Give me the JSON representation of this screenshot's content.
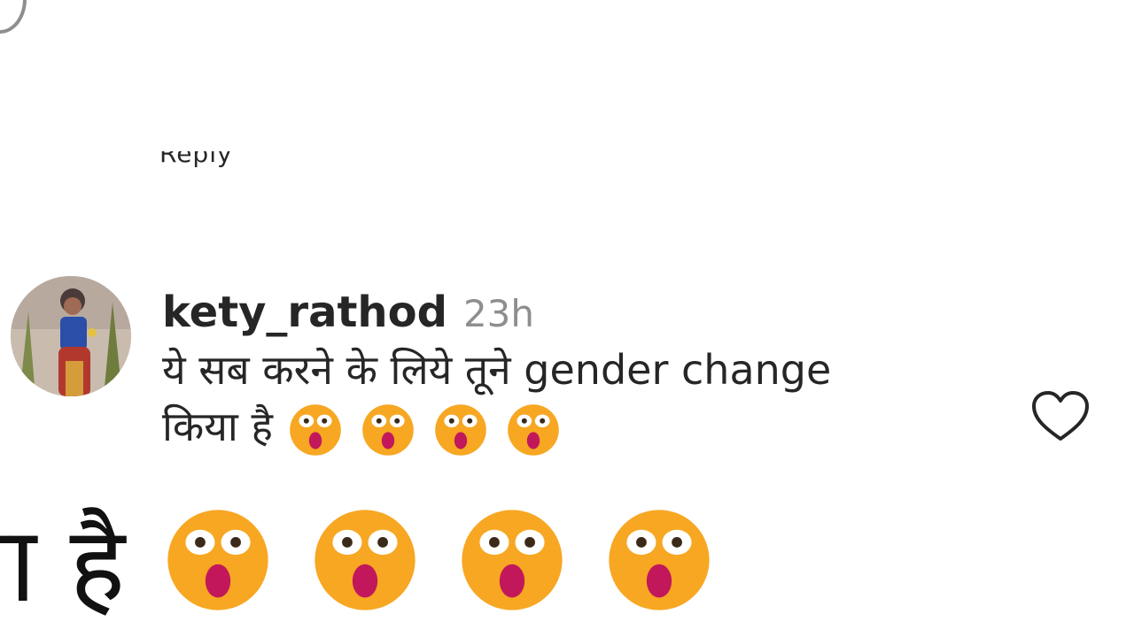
{
  "reply_prev": {
    "label": "Reply"
  },
  "comment": {
    "username": "kety_rathod",
    "timestamp": "23h",
    "text_line1": "ये सब करने के लिये तूने gender change",
    "text_line2": "किया है",
    "emoji_name": "astonished-face-icon",
    "emoji_count": 4,
    "like_icon": "heart-outline-icon"
  },
  "zoom": {
    "text": "या है",
    "emoji_count": 4
  },
  "colors": {
    "text": "#262626",
    "muted": "#8e8e8e",
    "emoji_face": "#f7a722",
    "emoji_mouth": "#c2185b"
  }
}
